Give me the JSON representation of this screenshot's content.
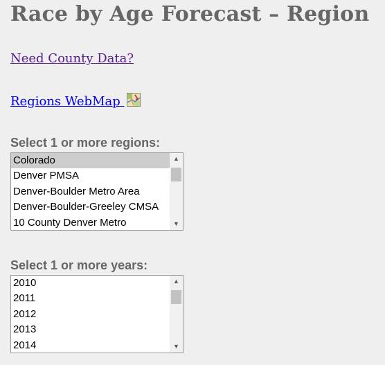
{
  "page": {
    "title": "Race by Age Forecast – Region"
  },
  "links": {
    "county_data": "Need County Data?",
    "regions_webmap": "Regions WebMap"
  },
  "icons": {
    "webmap": "map-icon"
  },
  "regions_select": {
    "label": "Select 1 or more regions:",
    "options": [
      "Colorado",
      "Denver PMSA",
      "Denver-Boulder Metro Area",
      "Denver-Boulder-Greeley CMSA",
      "10 County Denver Metro"
    ],
    "selected": "Colorado"
  },
  "years_select": {
    "label": "Select 1 or more years:",
    "options": [
      "2010",
      "2011",
      "2012",
      "2013",
      "2014"
    ]
  },
  "colors": {
    "background": "#efefef",
    "heading": "#666666",
    "visited_link": "#551a8b",
    "link": "#0000ee",
    "selected_option": "#cdcdcd"
  }
}
